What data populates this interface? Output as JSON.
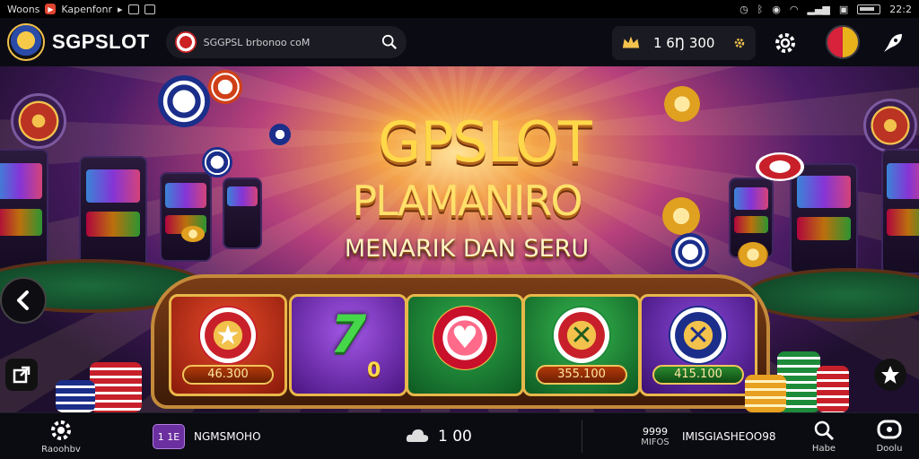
{
  "status_bar": {
    "left_text": "Woons",
    "app_name": "Kapenfonr",
    "time": "22:2"
  },
  "header": {
    "brand": "SGPSLOT",
    "search_text": "SGGPSL brbonoo coM",
    "balance": "1 6Ŋ 300"
  },
  "hero": {
    "title_line1": "GPSLOT",
    "title_line2": "PLAMANIRO",
    "title_line3": "MENARIK DAN SERU"
  },
  "reels": [
    {
      "symbol": "★",
      "amount": "46.300",
      "bg": "#c4321a"
    },
    {
      "symbol": "7",
      "amount": "0",
      "bg": "#7b2fc0"
    },
    {
      "symbol": "♥",
      "amount": "",
      "bg": "#1e8b3a"
    },
    {
      "symbol": "✕",
      "amount": "355.100",
      "bg": "#1e8b3a"
    },
    {
      "symbol": "✕",
      "amount": "415.100",
      "bg": "#6b2aa8"
    }
  ],
  "bottom_bar": {
    "left_label": "Raoohbv",
    "badge_text": "1 1E",
    "nav_text": "NGMSMOHO",
    "center_value": "1 00",
    "right_top": "9999",
    "right_bottom": "MIFOS",
    "right_text": "IMISGIASHEOO98",
    "profile_label": "Habe",
    "last_label": "Doolu"
  },
  "colors": {
    "accent_gold": "#ffd84a",
    "bar_bg": "#0b0b12"
  }
}
